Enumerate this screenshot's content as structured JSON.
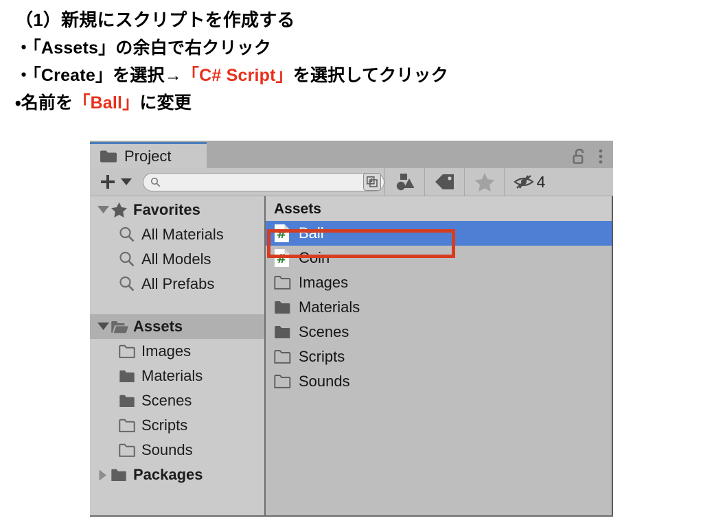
{
  "instructions": {
    "title": "（1）新規にスクリプトを作成する",
    "bullets": [
      {
        "parts": [
          {
            "text": "・「Assets」の余白で右クリック",
            "accent": false
          }
        ]
      },
      {
        "parts": [
          {
            "text": "・「Create」を選択→",
            "accent": false
          },
          {
            "text": "「C# Script」",
            "accent": true
          },
          {
            "text": "を選択してクリック",
            "accent": false
          }
        ]
      },
      {
        "parts": [
          {
            "text": "・名前を",
            "accent": false
          },
          {
            "text": "「Ball」",
            "accent": true
          },
          {
            "text": "に変更",
            "accent": false
          }
        ]
      }
    ]
  },
  "panel": {
    "tab": {
      "label": "Project",
      "icon": "folder-icon",
      "lock_icon": "unlocked-padlock-icon",
      "menu_icon": "kebab-menu-icon"
    },
    "toolbar": {
      "add_label": "+",
      "add_dropdown_icon": "chevron-down-icon",
      "search": {
        "value": "",
        "placeholder": "",
        "icon": "search-icon",
        "expand_icon": "expand-search-icon"
      },
      "filters": [
        {
          "name": "type-filter-icon",
          "label": ""
        },
        {
          "name": "label-filter-icon",
          "label": ""
        },
        {
          "name": "favorites-star-icon",
          "label": ""
        }
      ],
      "hidden_items": {
        "icon": "hidden-eye-icon",
        "count": "4"
      }
    },
    "tree": {
      "sections": [
        {
          "header": {
            "label": "Favorites",
            "icon": "star-icon",
            "expanded": true,
            "bold": true
          },
          "items": [
            {
              "label": "All Materials",
              "icon": "search-icon",
              "bold": false
            },
            {
              "label": "All Models",
              "icon": "search-icon",
              "bold": false
            },
            {
              "label": "All Prefabs",
              "icon": "search-icon",
              "bold": false
            }
          ]
        },
        {
          "header": {
            "label": "Assets",
            "icon": "open-folder-icon",
            "expanded": true,
            "bold": true,
            "selected": true
          },
          "items": [
            {
              "label": "Images",
              "icon": "folder-outline-icon",
              "bold": false
            },
            {
              "label": "Materials",
              "icon": "folder-filled-icon",
              "bold": false
            },
            {
              "label": "Scenes",
              "icon": "folder-filled-icon",
              "bold": false
            },
            {
              "label": "Scripts",
              "icon": "folder-outline-icon",
              "bold": false
            },
            {
              "label": "Sounds",
              "icon": "folder-outline-icon",
              "bold": false
            }
          ]
        }
      ],
      "packages": {
        "label": "Packages",
        "icon": "folder-filled-icon",
        "expanded": false,
        "bold": true
      }
    },
    "content": {
      "breadcrumb": "Assets",
      "items": [
        {
          "label": "Ball",
          "icon": "csharp-script-icon",
          "selected": true
        },
        {
          "label": "Coin",
          "icon": "csharp-script-icon",
          "selected": false
        },
        {
          "label": "Images",
          "icon": "folder-outline-icon",
          "selected": false
        },
        {
          "label": "Materials",
          "icon": "folder-filled-icon",
          "selected": false
        },
        {
          "label": "Scenes",
          "icon": "folder-filled-icon",
          "selected": false
        },
        {
          "label": "Scripts",
          "icon": "folder-outline-icon",
          "selected": false
        },
        {
          "label": "Sounds",
          "icon": "folder-outline-icon",
          "selected": false
        }
      ]
    }
  },
  "annotation": {
    "target": "Ball",
    "color": "#d63d20"
  },
  "colors": {
    "accent_red": "#e8301c",
    "selection_blue": "#4e7fd4",
    "tab_active_blue": "#4a7ebb",
    "panel_bg": "#c4c4c4",
    "left_pane_bg": "#cbcbcb",
    "right_pane_bg": "#bebebe",
    "csharp_green": "#2e7d32"
  }
}
